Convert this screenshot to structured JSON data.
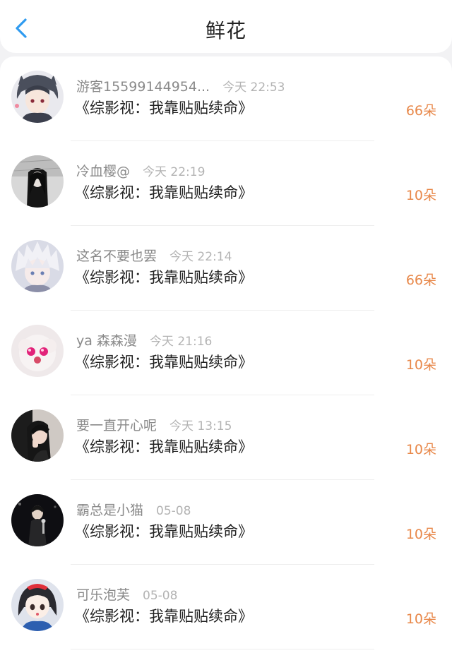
{
  "header": {
    "title": "鲜花",
    "back_icon": "chevron-left-icon",
    "accent": "#2f9bf0"
  },
  "colors": {
    "amount": "#e8884a",
    "name": "#8a8a8a",
    "time": "#b3b3b3",
    "title": "#222222"
  },
  "items": [
    {
      "user": "游客15599144954...",
      "time": "今天 22:53",
      "book": "《综影视：我靠贴贴续命》",
      "amount": "66朵"
    },
    {
      "user": "冷血樱@",
      "time": "今天 22:19",
      "book": "《综影视：我靠贴贴续命》",
      "amount": "10朵"
    },
    {
      "user": "这名不要也罢",
      "time": "今天 22:14",
      "book": "《综影视：我靠贴贴续命》",
      "amount": "66朵"
    },
    {
      "user": "ya 森森漫",
      "time": "今天 21:16",
      "book": "《综影视：我靠贴贴续命》",
      "amount": "10朵"
    },
    {
      "user": "要一直开心呢",
      "time": "今天 13:15",
      "book": "《综影视：我靠贴贴续命》",
      "amount": "10朵"
    },
    {
      "user": "霸总是小猫",
      "time": "05-08",
      "book": "《综影视：我靠贴贴续命》",
      "amount": "10朵"
    },
    {
      "user": "可乐泡芙",
      "time": "05-08",
      "book": "《综影视：我靠贴贴续命》",
      "amount": "10朵"
    }
  ]
}
